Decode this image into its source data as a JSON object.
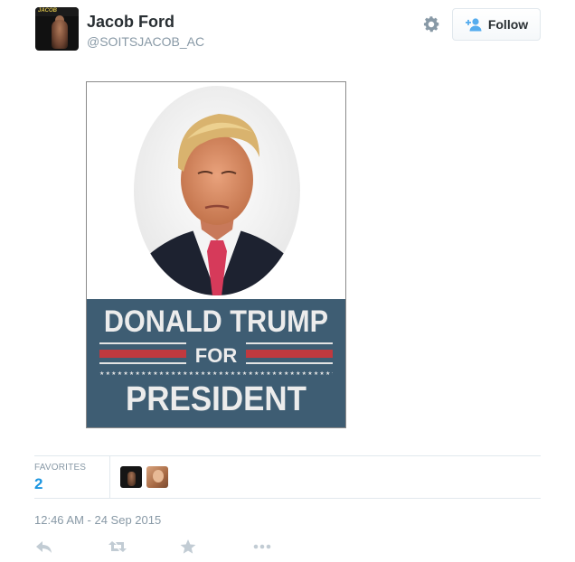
{
  "tweet": {
    "author": {
      "name": "Jacob Ford",
      "handle": "@SOITSJACOB_AC",
      "avatar_icon": "profile-photo",
      "avatar_text": "JACOB"
    },
    "follow_button": {
      "label": "Follow",
      "icon": "add-user-icon"
    },
    "settings_icon": "gear-icon",
    "media": {
      "line1": "DONALD TRUMP",
      "line2": "FOR",
      "line3": "PRESIDENT",
      "banner_color": "#3e5d73",
      "stripe_color": "#c0393f"
    },
    "stats": {
      "favorites_label": "FAVORITES",
      "favorites_count": "2"
    },
    "timestamp": "12:46 AM - 24 Sep 2015",
    "actions": [
      "reply-icon",
      "retweet-icon",
      "favorite-icon",
      "more-icon"
    ]
  },
  "colors": {
    "link": "#1b95e0",
    "muted": "#8899a6",
    "text": "#292f33"
  }
}
